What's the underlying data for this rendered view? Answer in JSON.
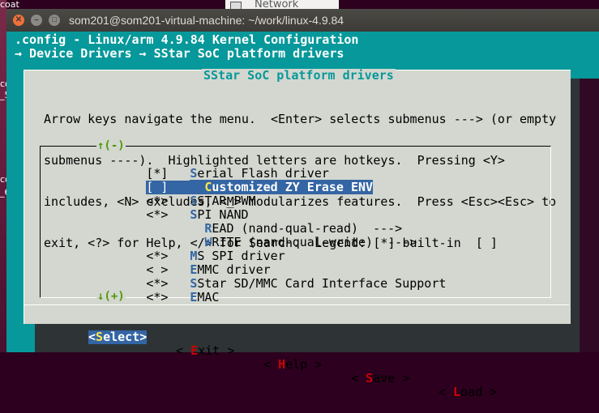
{
  "desktop": {
    "labels": [
      "coat",
      "co",
      "_5",
      "co",
      "_6"
    ],
    "bg_window_title": "Network"
  },
  "window": {
    "title": "som201@som201-virtual-machine: ~/work/linux-4.9.84",
    "buttons": [
      "close",
      "minimize",
      "maximize"
    ]
  },
  "header": {
    "config_line": ".config - Linux/arm 4.9.84 Kernel Configuration",
    "breadcrumb": "→ Device Drivers → SStar SoC platform drivers"
  },
  "dialog": {
    "title": "SStar SoC platform drivers",
    "help_lines": [
      "Arrow keys navigate the menu.  <Enter> selects submenus ---> (or empty",
      "submenus ----).  Highlighted letters are hotkeys.  Pressing <Y>",
      "includes, <N> excludes, <M> modularizes features.  Press <Esc><Esc> to",
      "exit, <?> for Help, </> for Search.  Legend: [*] built-in  [ ]"
    ],
    "scroll_up": "↑(-)",
    "scroll_down": "↓(+)"
  },
  "menu_items": [
    {
      "prefix": "[*]",
      "indent": "",
      "hot": "S",
      "rest": "erial Flash driver"
    },
    {
      "prefix": "[ ]",
      "indent": "  ",
      "hot": "C",
      "rest": "ustomized ZY Erase ENV",
      "selected": true
    },
    {
      "prefix": "<*>",
      "indent": "",
      "hot": "S",
      "rest": "STAR_PWM"
    },
    {
      "prefix": "<*>",
      "indent": "",
      "hot": "S",
      "rest": "PI NAND"
    },
    {
      "prefix": "",
      "indent": "  ",
      "hot": "R",
      "rest": "EAD (nand-qual-read)  --->"
    },
    {
      "prefix": "",
      "indent": "  ",
      "hot": "W",
      "rest": "RITE (nand-qual-write)  --->"
    },
    {
      "prefix": "<*>",
      "indent": "",
      "hot": "M",
      "rest": "S SPI driver"
    },
    {
      "prefix": "< >",
      "indent": "",
      "hot": "E",
      "rest": "MMC driver"
    },
    {
      "prefix": "<*>",
      "indent": "",
      "hot": "S",
      "rest": "Star SD/MMC Card Interface Support"
    },
    {
      "prefix": "<*>",
      "indent": "",
      "hot": "E",
      "rest": "MAC"
    }
  ],
  "buttons": {
    "select": {
      "open": "<",
      "hot": "S",
      "rest": "elect",
      "close": ">"
    },
    "exit": {
      "open": "< ",
      "hot": "E",
      "rest": "xit",
      "close": " >"
    },
    "help": {
      "open": "< ",
      "hot": "H",
      "rest": "elp",
      "close": " >"
    },
    "save": {
      "open": "< ",
      "hot": "S",
      "rest": "ave",
      "close": " >"
    },
    "load": {
      "open": "< ",
      "hot": "L",
      "rest": "oad",
      "close": " >"
    }
  },
  "colors": {
    "screen_bg": "#06989a",
    "dialog_bg": "#d3d7cf",
    "highlight": "#3465a4",
    "hotkey_menu": "#3465a4",
    "hotkey_button": "#cc0000",
    "hotkey_selected": "#fce94f",
    "scroll_arrow": "#4e9a06"
  }
}
